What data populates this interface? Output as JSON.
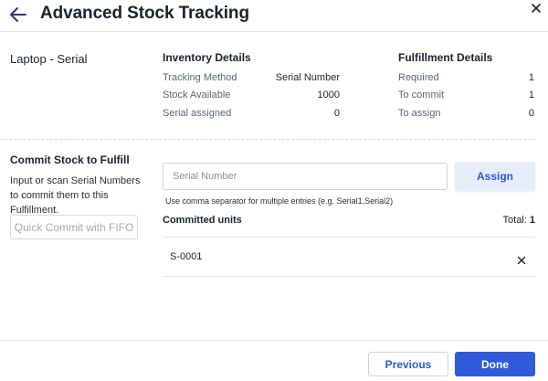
{
  "header": {
    "title": "Advanced Stock Tracking",
    "back_icon": "arrow-left-icon",
    "close_icon": "close-icon"
  },
  "product": {
    "name": "Laptop - Serial"
  },
  "inventory": {
    "title": "Inventory Details",
    "rows": [
      {
        "label": "Tracking Method",
        "value": "Serial Number"
      },
      {
        "label": "Stock Available",
        "value": "1000"
      },
      {
        "label": "Serial assigned",
        "value": "0"
      }
    ]
  },
  "fulfillment": {
    "title": "Fulfillment Details",
    "rows": [
      {
        "label": "Required",
        "value": "1"
      },
      {
        "label": "To commit",
        "value": "1"
      },
      {
        "label": "To assign",
        "value": "0"
      }
    ]
  },
  "commit": {
    "title": "Commit Stock to Fulfill",
    "description": "Input or scan Serial Numbers to commit them to this Fulfillment.",
    "fifo_label": "Quick Commit with FIFO",
    "input_placeholder": "Serial Number",
    "input_value": "",
    "assign_label": "Assign",
    "hint": "Use comma separator for multiple entries (e.g. Serial1,Serial2)"
  },
  "committed": {
    "title": "Committed units",
    "total_label": "Total:",
    "total_value": "1",
    "items": [
      {
        "serial": "S-0001"
      }
    ]
  },
  "footer": {
    "previous_label": "Previous",
    "done_label": "Done"
  },
  "colors": {
    "accent": "#2f5bd8",
    "assign_bg": "#e6edfb",
    "label_gray": "#5b6478"
  }
}
